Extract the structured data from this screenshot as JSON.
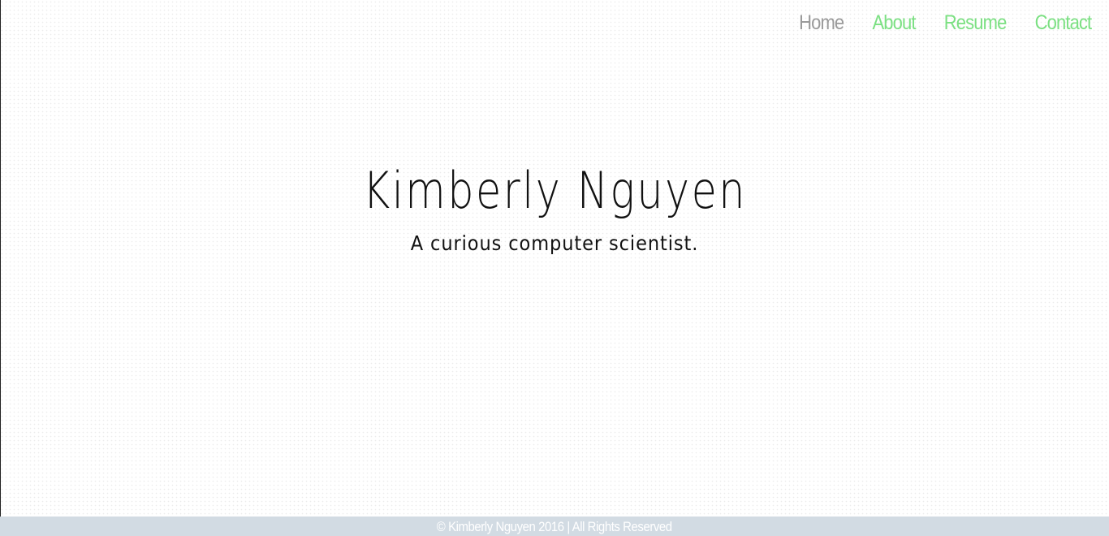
{
  "nav": {
    "items": [
      {
        "label": "Home",
        "active": true
      },
      {
        "label": "About",
        "active": false
      },
      {
        "label": "Resume",
        "active": false
      },
      {
        "label": "Contact",
        "active": false
      }
    ]
  },
  "hero": {
    "name": "Kimberly Nguyen",
    "tagline": "A curious computer scientist."
  },
  "footer": {
    "text": "© Kimberly Nguyen 2016 | All Rights Reserved"
  },
  "colors": {
    "nav_link": "#7be082",
    "nav_active": "#9a9a9a",
    "footer_bg": "#d2dbe3",
    "text": "#111111"
  }
}
